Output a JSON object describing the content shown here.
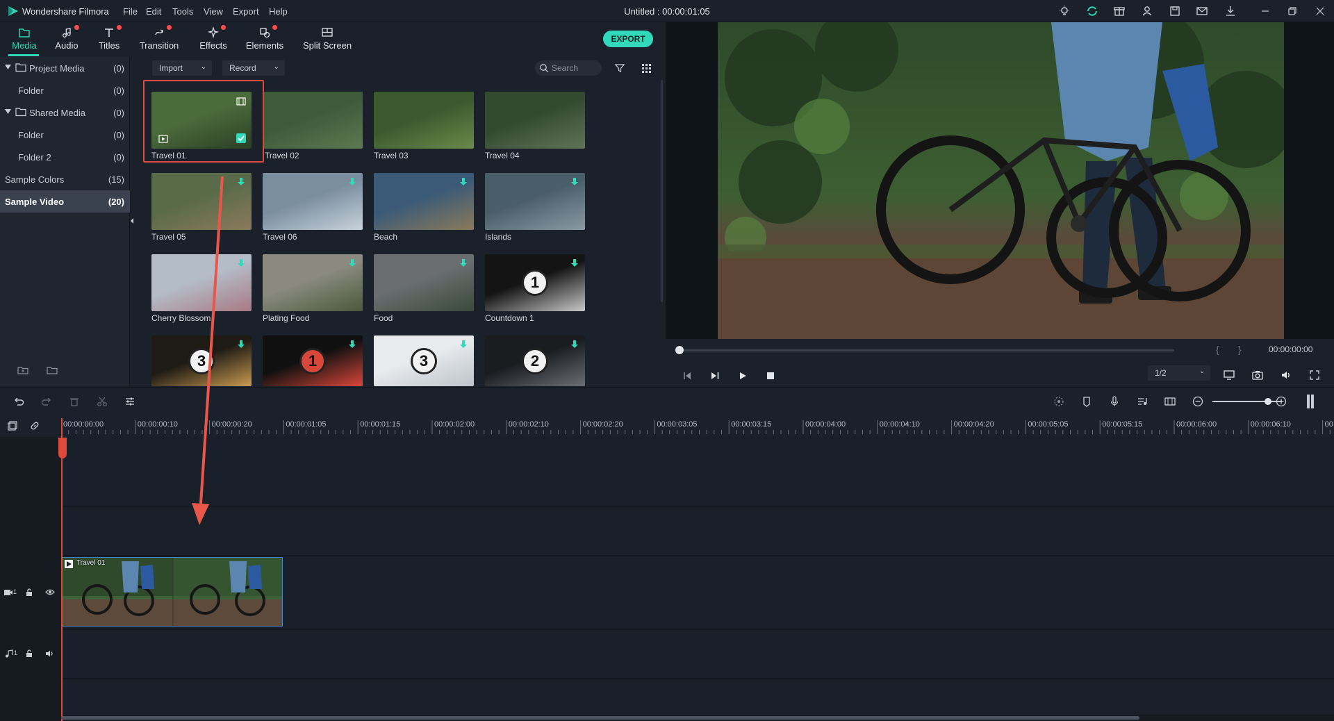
{
  "window": {
    "app_name": "Wondershare Filmora",
    "title": "Untitled : 00:00:01:05",
    "menu": [
      "File",
      "Edit",
      "Tools",
      "View",
      "Export",
      "Help"
    ]
  },
  "tabs": [
    {
      "label": "Media",
      "icon": "folder-icon",
      "active": true,
      "notify": false
    },
    {
      "label": "Audio",
      "icon": "music-note-icon",
      "active": false,
      "notify": true
    },
    {
      "label": "Titles",
      "icon": "text-t-icon",
      "active": false,
      "notify": true
    },
    {
      "label": "Transition",
      "icon": "transition-icon",
      "active": false,
      "notify": true
    },
    {
      "label": "Effects",
      "icon": "effects-sparkle-icon",
      "active": false,
      "notify": true
    },
    {
      "label": "Elements",
      "icon": "elements-icon",
      "active": false,
      "notify": true
    },
    {
      "label": "Split Screen",
      "icon": "split-screen-icon",
      "active": false,
      "notify": false
    }
  ],
  "export_label": "EXPORT",
  "library": {
    "items": [
      {
        "name": "Project Media",
        "count": "(0)",
        "expandable": true,
        "folder": true,
        "selected": false
      },
      {
        "name": "Folder",
        "count": "(0)",
        "expandable": false,
        "folder": false,
        "selected": false
      },
      {
        "name": "Shared Media",
        "count": "(0)",
        "expandable": true,
        "folder": true,
        "selected": false
      },
      {
        "name": "Folder",
        "count": "(0)",
        "expandable": false,
        "folder": false,
        "selected": false
      },
      {
        "name": "Folder 2",
        "count": "(0)",
        "expandable": false,
        "folder": false,
        "selected": false
      },
      {
        "name": "Sample Colors",
        "count": "(15)",
        "expandable": false,
        "folder": false,
        "selected": false
      },
      {
        "name": "Sample Video",
        "count": "(20)",
        "expandable": false,
        "folder": false,
        "selected": true
      }
    ]
  },
  "media_toolbar": {
    "import_label": "Import",
    "record_label": "Record",
    "search_placeholder": "Search"
  },
  "media": [
    {
      "label": "Travel 01",
      "bg": "#4a6b3a",
      "bg2": "#2c3f26",
      "download": false,
      "selected": true
    },
    {
      "label": "Travel 02",
      "bg": "#3d5a3a",
      "bg2": "#5e7a52",
      "download": false,
      "selected": false
    },
    {
      "label": "Travel 03",
      "bg": "#3a5a2e",
      "bg2": "#6b8a4a",
      "download": false,
      "selected": false
    },
    {
      "label": "Travel 04",
      "bg": "#344a30",
      "bg2": "#61745a",
      "download": false,
      "selected": false
    },
    {
      "label": "Travel 05",
      "bg": "#5a6b4a",
      "bg2": "#8b7a5a",
      "download": true,
      "selected": false
    },
    {
      "label": "Travel 06",
      "bg": "#7a8ea0",
      "bg2": "#c8d2da",
      "download": true,
      "selected": false
    },
    {
      "label": "Beach",
      "bg": "#3a5a78",
      "bg2": "#8a7a5a",
      "download": true,
      "selected": false
    },
    {
      "label": "Islands",
      "bg": "#4a5e6a",
      "bg2": "#8a9aa4",
      "download": true,
      "selected": false
    },
    {
      "label": "Cherry Blossom",
      "bg": "#b4bcc8",
      "bg2": "#a87a84",
      "download": true,
      "selected": false
    },
    {
      "label": "Plating Food",
      "bg": "#8a8a80",
      "bg2": "#4a5a3a",
      "download": true,
      "selected": false
    },
    {
      "label": "Food",
      "bg": "#6a6e70",
      "bg2": "#3a4a3a",
      "download": true,
      "selected": false
    },
    {
      "label": "Countdown 1",
      "bg": "#141414",
      "bg2": "#c8c8c8",
      "download": true,
      "selected": false
    },
    {
      "label": "",
      "bg": "#1e1a14",
      "bg2": "#c89a50",
      "download": true,
      "selected": false
    },
    {
      "label": "",
      "bg": "#101010",
      "bg2": "#d9463a",
      "download": true,
      "selected": false
    },
    {
      "label": "",
      "bg": "#e8eaec",
      "bg2": "#bcc4cc",
      "download": true,
      "selected": false
    },
    {
      "label": "",
      "bg": "#1a1c20",
      "bg2": "#6a6e74",
      "download": true,
      "selected": false
    }
  ],
  "badge_numbers": {
    "countdown1": "1",
    "cd_a": "3",
    "cd_b": "1",
    "cd_c": "3",
    "cd_d": "2"
  },
  "player": {
    "timecode": "00:00:00:00",
    "quality": "1/2",
    "progress": 0.0
  },
  "timeline": {
    "ticks": [
      "00:00:00:00",
      "00:00:00:10",
      "00:00:00:20",
      "00:00:01:05",
      "00:00:01:15",
      "00:00:02:00",
      "00:00:02:10",
      "00:00:02:20",
      "00:00:03:05",
      "00:00:03:15",
      "00:00:04:00",
      "00:00:04:10",
      "00:00:04:20",
      "00:00:05:05",
      "00:00:05:15",
      "00:00:06:00",
      "00:00:06:10",
      "00"
    ],
    "clip_label": "Travel 01",
    "video_track_label": "1",
    "audio_track_label": "1",
    "zoom": 0.8
  },
  "colors": {
    "accent": "#2fd9b9",
    "notify": "#ff4d4d",
    "highlight": "#e04a3d",
    "clip_border": "#4a82c4"
  }
}
